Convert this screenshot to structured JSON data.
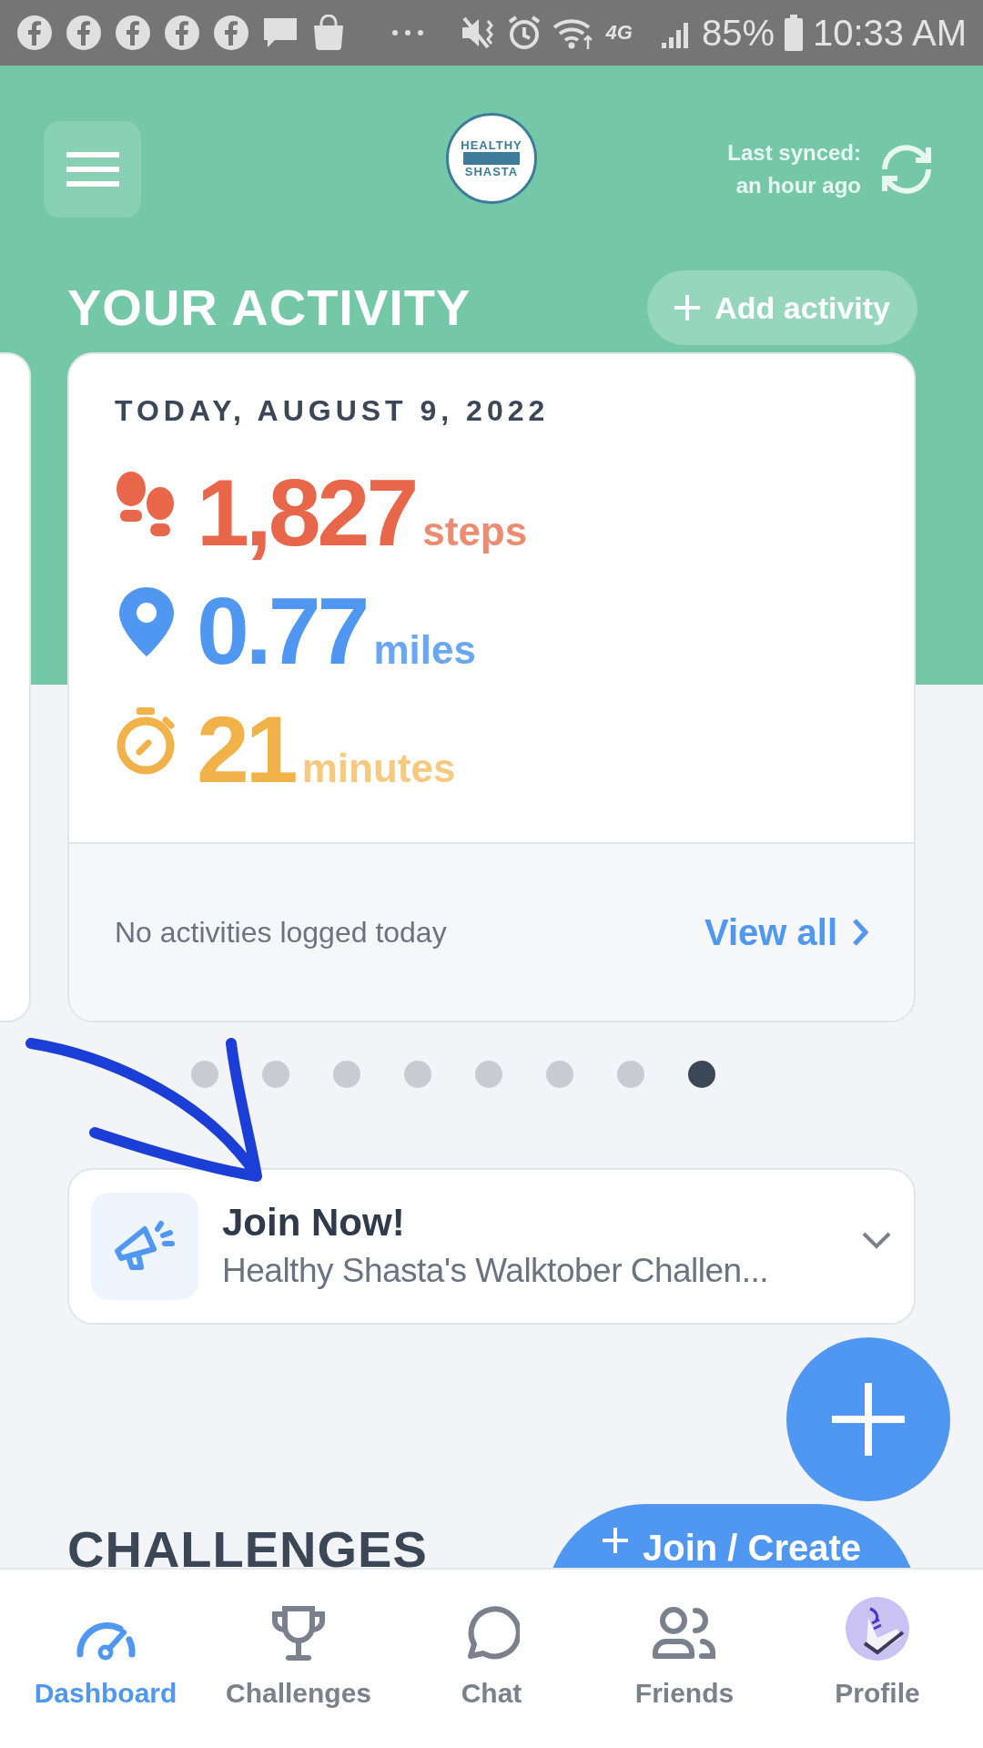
{
  "status_bar": {
    "battery": "85%",
    "time": "10:33 AM",
    "network": "4G"
  },
  "header": {
    "logo_lines": [
      "HEALTHY",
      "SHASTA"
    ],
    "sync_label": "Last synced:",
    "sync_time": "an hour ago"
  },
  "activity": {
    "title": "YOUR ACTIVITY",
    "add_button": "Add activity",
    "date": "TODAY, AUGUST 9, 2022",
    "metrics": [
      {
        "kind": "steps",
        "value": "1,827",
        "unit": "steps"
      },
      {
        "kind": "distance",
        "value": "0.77",
        "unit": "miles"
      },
      {
        "kind": "time",
        "value": "21",
        "unit": "minutes"
      }
    ],
    "footer_text": "No activities logged today",
    "view_all": "View all"
  },
  "pager": [
    {
      "selected": false
    },
    {
      "selected": false
    },
    {
      "selected": false
    },
    {
      "selected": false
    },
    {
      "selected": false
    },
    {
      "selected": false
    },
    {
      "selected": false
    },
    {
      "selected": true
    }
  ],
  "announcement": {
    "title": "Join Now!",
    "text": "Healthy Shasta's Walktober Challen..."
  },
  "challenges": {
    "title": "CHALLENGES",
    "button": "Join / Create"
  },
  "nav": [
    {
      "label": "Dashboard",
      "kind": "dashboard",
      "selected": true
    },
    {
      "label": "Challenges",
      "kind": "challenges",
      "selected": false
    },
    {
      "label": "Chat",
      "kind": "chat",
      "selected": false
    },
    {
      "label": "Friends",
      "kind": "friends",
      "selected": false
    },
    {
      "label": "Profile",
      "kind": "profile",
      "selected": false
    }
  ]
}
